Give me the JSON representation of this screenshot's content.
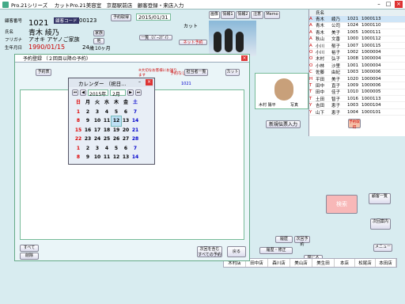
{
  "title": "Pro.21シリーズ　 カットPro.21美容室　京都駅前店　顧客登録・来店入力",
  "customer": {
    "id_label": "顧客番号",
    "code_label": "顧客コード",
    "code": "00123",
    "number": "1021",
    "name_label": "氏名",
    "name": "青木 綾乃",
    "kana_label": "フリガナ",
    "kana": "アオキ アヤノご家族",
    "birth_label": "生年月日",
    "birth": "1990/01/15",
    "age": "24",
    "age_unit": "歳",
    "months": "10ヶ月",
    "btn_family": "家族",
    "btn_other": "他"
  },
  "appt": {
    "btn": "予約取得",
    "date": "2015/01/31",
    "cut": "カット",
    "btn_list": "一覧（ﾊﾞｰｽﾃﾞｲ）",
    "btn_net": "ネット予約"
  },
  "tabs": [
    "画像",
    "情報1",
    "情報2",
    "注意",
    "Memo"
  ],
  "staff": {
    "name": "木村 陽平",
    "photo_btn": "写真"
  },
  "subwin": {
    "title": "予約登録 （２回目以降の予約）",
    "btn_predict": "予約表",
    "red1": "※大切なお客様にお送り",
    "red2": "ます",
    "label_mid": "予約なし",
    "btn_stylist": "担当者一覧",
    "btn_cut": "カット",
    "btn_all": "すべて",
    "btn_all2": "削除",
    "num": "1021",
    "btn_next": "次回を含む\nすべての予約",
    "btn_back": "戻る"
  },
  "calendar": {
    "title": "カレンダー （祝日...",
    "year": "2015年",
    "month": "2月",
    "weekdays": [
      "日",
      "月",
      "火",
      "水",
      "木",
      "金",
      "土"
    ],
    "days": [
      [
        "1",
        "2",
        "3",
        "4",
        "5",
        "6",
        "7"
      ],
      [
        "8",
        "9",
        "10",
        "11",
        "12",
        "13",
        "14"
      ],
      [
        "15",
        "16",
        "17",
        "18",
        "19",
        "20",
        "21"
      ],
      [
        "22",
        "23",
        "24",
        "25",
        "26",
        "27",
        "28"
      ],
      [
        "1",
        "2",
        "3",
        "4",
        "5",
        "6",
        "7"
      ],
      [
        "8",
        "9",
        "10",
        "11",
        "12",
        "13",
        "14"
      ]
    ],
    "selected": "12"
  },
  "rightlist": {
    "header": "氏名",
    "rows": [
      [
        "A",
        "青木",
        "綾乃",
        "1021",
        "1000113"
      ],
      [
        "A",
        "青木",
        "公司",
        "1024",
        "1000110"
      ],
      [
        "A",
        "青木",
        "美子",
        "1005",
        "1000111"
      ],
      [
        "A",
        "秋山",
        "文香",
        "1000",
        "1000112"
      ],
      [
        "A",
        "小川",
        "郁子",
        "1007",
        "1000115"
      ],
      [
        "O",
        "小川",
        "裕子",
        "1002",
        "1000004"
      ],
      [
        "O",
        "木村",
        "弘子",
        "1008",
        "1000004"
      ],
      [
        "O",
        "小林",
        "沙里",
        "1001",
        "1000004"
      ],
      [
        "C",
        "佐藤",
        "由紀",
        "1003",
        "1000006"
      ],
      [
        "H",
        "平田",
        "美子",
        "1020",
        "1000004"
      ],
      [
        "T",
        "田中",
        "直子",
        "1009",
        "1000006"
      ],
      [
        "T",
        "田中",
        "佳子",
        "1010",
        "1000005"
      ],
      [
        "T",
        "土田",
        "智子",
        "1016",
        "1000113"
      ],
      [
        "Y",
        "吉田",
        "恵子",
        "1003",
        "1000104"
      ],
      [
        "Y",
        "山下",
        "恵子",
        "1004",
        "1000101"
      ]
    ]
  },
  "right_panel": {
    "btn_new": "新規伝票入力",
    "btn_wait": "予約取得",
    "btn_search": "検索",
    "btn_cust_list": "顧客一覧",
    "btn_guide": "次回案内",
    "btn_menu": "メニュー",
    "btn_close": "閉じる"
  },
  "bottom_btns": [
    "履歴",
    "履歴・修正",
    "次回予約"
  ],
  "footer": [
    "木村店",
    "田中店",
    "森川店",
    "美山店",
    "美生田",
    "本店",
    "松尾店",
    "本田店"
  ],
  "colors": {
    "bg": "#d8ecf0",
    "accent": "#c00000",
    "cal_sel": "#bde0f5"
  }
}
